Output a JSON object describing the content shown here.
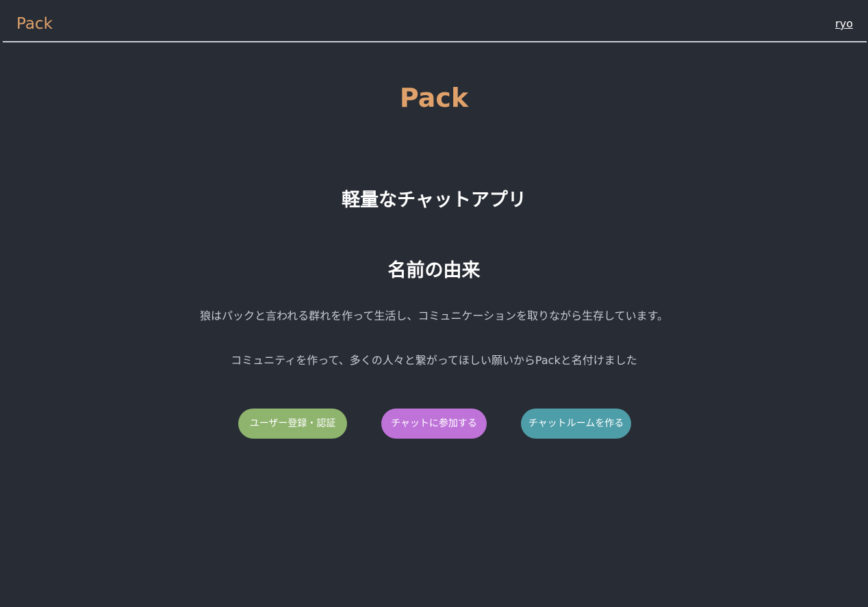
{
  "navbar": {
    "brand": "Pack",
    "user": "ryo"
  },
  "main": {
    "title": "Pack",
    "subtitle": "軽量なチャットアプリ",
    "section_title": "名前の由来",
    "paragraphs": [
      "狼はパックと言われる群れを作って生活し、コミュニケーションを取りながら生存しています。",
      "コミュニティを作って、多くの人々と繋がってほしい願いからPackと名付けました"
    ]
  },
  "buttons": {
    "register": "ユーザー登録・認証",
    "join": "チャットに参加する",
    "create": "チャットルームを作る"
  },
  "colors": {
    "background": "#282c34",
    "accent": "#e0a26a",
    "register_button": "#8fb46e",
    "join_button": "#bf73d9",
    "create_button": "#4e9ea9"
  }
}
